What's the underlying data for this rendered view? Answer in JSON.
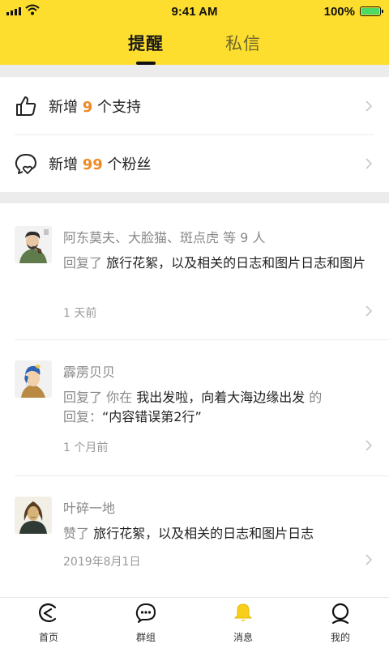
{
  "status_bar": {
    "time": "9:41 AM",
    "battery": "100%",
    "battery_level": 1.0
  },
  "tabs": [
    {
      "label": "提醒",
      "active": true
    },
    {
      "label": "私信",
      "active": false
    }
  ],
  "summary": [
    {
      "icon": "thumbs-up-icon",
      "prefix": "新增",
      "count": "9",
      "suffix": "个支持"
    },
    {
      "icon": "fans-heart-icon",
      "prefix": "新增",
      "count": "99",
      "suffix": "个粉丝"
    }
  ],
  "notifications": [
    {
      "avatar": "avatar-man-with-pipe",
      "names": "阿东莫夫、大脸猫、斑点虎  等 9 人",
      "action": "回复了",
      "target": "旅行花絮，以及相关的日志和图片日志和图片",
      "date": "1 天前"
    },
    {
      "avatar": "avatar-girl-with-pearl-earring",
      "names": "霹雳贝贝",
      "action": "回复了 你在",
      "target": "我出发啦，向着大海边缘出发",
      "tail": "的",
      "reply_prefix": "回复：",
      "reply": "“内容错误第2行”",
      "date": "1 个月前"
    },
    {
      "avatar": "avatar-mona-lisa",
      "names": "叶碎一地",
      "action": "赞了",
      "target": "旅行花絮，以及相关的日志和图片日志",
      "date": "2019年8月1日"
    }
  ],
  "tabbar": [
    {
      "icon": "home-icon",
      "label": "首页"
    },
    {
      "icon": "group-chat-icon",
      "label": "群组"
    },
    {
      "icon": "bell-icon",
      "label": "消息"
    },
    {
      "icon": "profile-icon",
      "label": "我的"
    }
  ],
  "colors": {
    "brand_yellow": "#fddd2d",
    "count_orange": "#f08a24",
    "muted_text": "#888888"
  }
}
